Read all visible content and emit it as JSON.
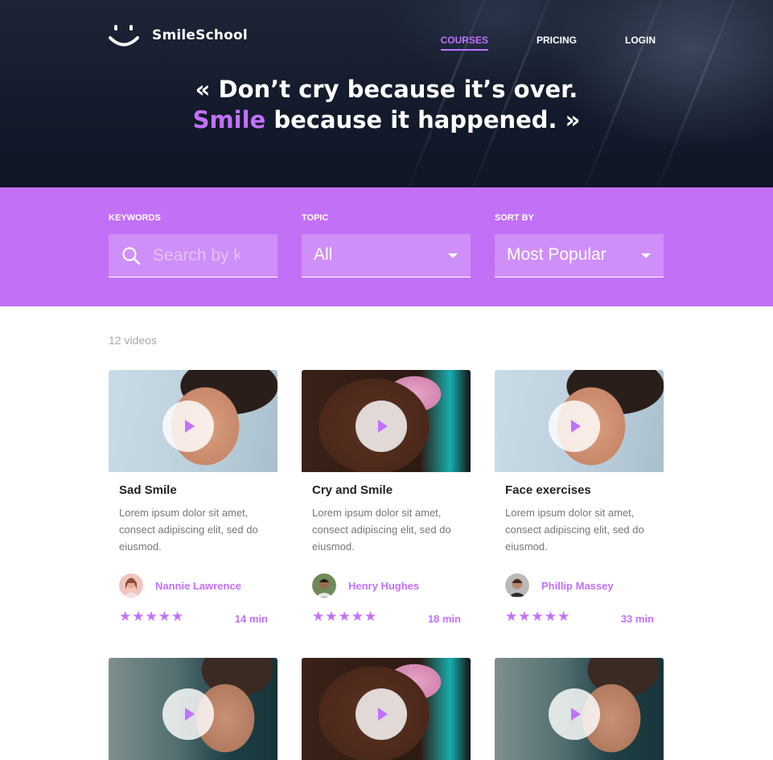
{
  "header": {
    "brand": "SmileSchool",
    "nav": [
      {
        "label": "COURSES",
        "active": true
      },
      {
        "label": "PRICING",
        "active": false
      },
      {
        "label": "LOGIN",
        "active": false
      }
    ],
    "quote_line1": "« Don’t cry because it’s over.",
    "quote_highlight": "Smile",
    "quote_line2_rest": " because it happened. »"
  },
  "filters": {
    "keywords_label": "KEYWORDS",
    "keywords_placeholder": "Search by keywords",
    "topic_label": "TOPIC",
    "topic_value": "All",
    "sort_label": "SORT BY",
    "sort_value": "Most Popular"
  },
  "results": {
    "count": "12 videos",
    "cards": [
      {
        "title": "Sad Smile",
        "description": "Lorem ipsum dolor sit amet, consect adipiscing elit, sed do eiusmod.",
        "author": "Nannie Lawrence",
        "rating": 5,
        "duration": "14 min"
      },
      {
        "title": "Cry and Smile",
        "description": "Lorem ipsum dolor sit amet, consect adipiscing elit, sed do eiusmod.",
        "author": "Henry Hughes",
        "rating": 5,
        "duration": "18 min"
      },
      {
        "title": "Face exercises",
        "description": "Lorem ipsum dolor sit amet, consect adipiscing elit, sed do eiusmod.",
        "author": "Phillip Massey",
        "rating": 5,
        "duration": "33 min"
      }
    ]
  },
  "icons": {
    "logo": "smiley-logo-icon",
    "search": "search-icon",
    "dropdown": "caret-down-icon",
    "play": "play-icon",
    "star": "star-icon"
  },
  "colors": {
    "accent": "#c271ff",
    "filter_bar": "#c270f6",
    "hero_bg": "#131b2c"
  }
}
